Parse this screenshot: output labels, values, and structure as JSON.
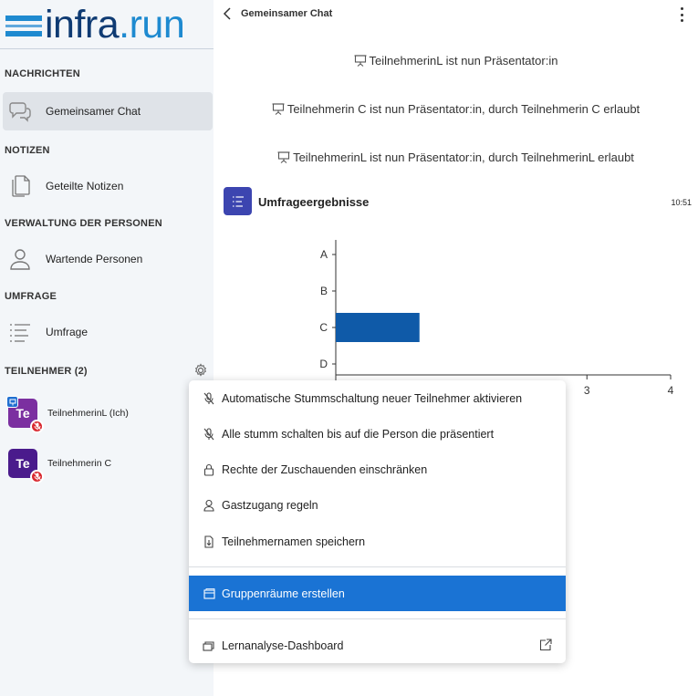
{
  "logo": {
    "part1": "infra",
    "part2": ".run"
  },
  "sidebar": {
    "sections": {
      "messages": "NACHRICHTEN",
      "notes": "NOTIZEN",
      "management": "VERWALTUNG DER PERSONEN",
      "poll": "UMFRAGE",
      "participants": "TEILNEHMER (2)"
    },
    "items": {
      "chat": "Gemeinsamer Chat",
      "notes": "Geteilte Notizen",
      "waiting": "Wartende Personen",
      "poll": "Umfrage"
    },
    "users": [
      {
        "initials": "Te",
        "name": "TeilnehmerinL (Ich)",
        "color": "#7b2fa0"
      },
      {
        "initials": "Te",
        "name": "Teilnehmerin C",
        "color": "#4a1b8c"
      }
    ]
  },
  "chat": {
    "title": "Gemeinsamer Chat",
    "messages": [
      "TeilnehmerinL ist nun Präsentator:in",
      "Teilnehmerin C ist nun Präsentator:in, durch Teilnehmerin C erlaubt",
      "TeilnehmerinL ist nun Präsentator:in, durch TeilnehmerinL erlaubt"
    ],
    "poll": {
      "title": "Umfrageergebnisse",
      "time": "10:51"
    }
  },
  "chart_data": {
    "type": "bar",
    "orientation": "horizontal",
    "categories": [
      "A",
      "B",
      "C",
      "D"
    ],
    "values": [
      0,
      0,
      1,
      0
    ],
    "xticks": [
      "3",
      "4"
    ],
    "xlim": [
      0,
      4
    ],
    "bar_color": "#0f5aa8"
  },
  "menu": {
    "items": [
      {
        "label": "Automatische Stummschaltung neuer Teilnehmer aktivieren",
        "icon": "mic-off-icon"
      },
      {
        "label": "Alle stumm schalten bis auf die Person die präsentiert",
        "icon": "mic-off-icon"
      },
      {
        "label": "Rechte der Zuschauenden einschränken",
        "icon": "lock-icon"
      },
      {
        "label": "Gastzugang regeln",
        "icon": "user-icon"
      },
      {
        "label": "Teilnehmernamen speichern",
        "icon": "download-file-icon"
      }
    ],
    "breakout": "Gruppenräume erstellen",
    "dashboard": "Lernanalyse-Dashboard"
  },
  "colors": {
    "accent": "#1a73d4",
    "logo_dark": "#0f3b73",
    "logo_light": "#1e8ad0",
    "mute": "#d9282f"
  }
}
